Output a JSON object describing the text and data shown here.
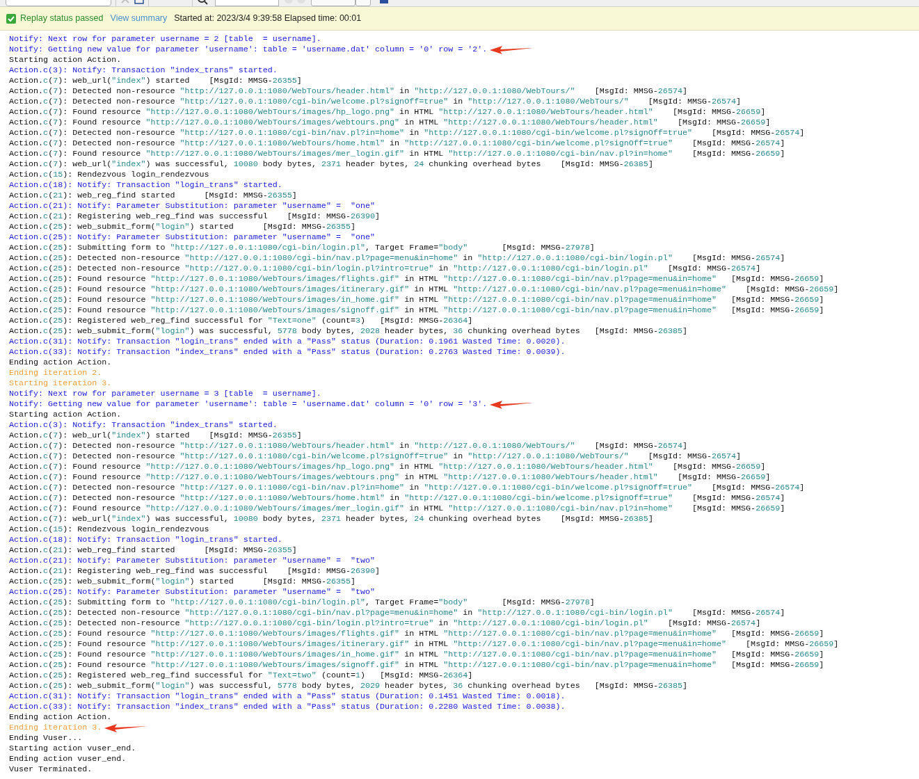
{
  "status_bar": {
    "status": "Replay status passed",
    "passed": true,
    "link": "View summary",
    "info": "Started at: 2023/3/4 9:39:58 Elapsed time: 00:01"
  },
  "log_lines": [
    {
      "kind": "notify",
      "text": "Notify: Next row for parameter username = 2 [table  = username].",
      "arrow": false
    },
    {
      "kind": "notify",
      "text": "Notify: Getting new value for parameter 'username': table = 'username.dat' column = '0' row = '2'.",
      "arrow": true
    },
    {
      "kind": "normal",
      "text": "Starting action Action.",
      "arrow": false
    },
    {
      "kind": "notify",
      "text": "Action.c(3): Notify: Transaction \"index_trans\" started.",
      "arrow": false
    },
    {
      "kind": "normal",
      "text": "Action.c(7): web_url(\"index\") started    [MsgId: MMSG-26355]",
      "arrow": false
    },
    {
      "kind": "normal",
      "text": "Action.c(7): Detected non-resource \"http://127.0.0.1:1080/WebTours/header.html\" in \"http://127.0.0.1:1080/WebTours/\"    [MsgId: MMSG-26574]",
      "arrow": false
    },
    {
      "kind": "normal",
      "text": "Action.c(7): Detected non-resource \"http://127.0.0.1:1080/cgi-bin/welcome.pl?signOff=true\" in \"http://127.0.0.1:1080/WebTours/\"    [MsgId: MMSG-26574]",
      "arrow": false
    },
    {
      "kind": "normal",
      "text": "Action.c(7): Found resource \"http://127.0.0.1:1080/WebTours/images/hp_logo.png\" in HTML \"http://127.0.0.1:1080/WebTours/header.html\"    [MsgId: MMSG-26659]",
      "arrow": false
    },
    {
      "kind": "normal",
      "text": "Action.c(7): Found resource \"http://127.0.0.1:1080/WebTours/images/webtours.png\" in HTML \"http://127.0.0.1:1080/WebTours/header.html\"    [MsgId: MMSG-26659]",
      "arrow": false
    },
    {
      "kind": "normal",
      "text": "Action.c(7): Detected non-resource \"http://127.0.0.1:1080/cgi-bin/nav.pl?in=home\" in \"http://127.0.0.1:1080/cgi-bin/welcome.pl?signOff=true\"    [MsgId: MMSG-26574]",
      "arrow": false
    },
    {
      "kind": "normal",
      "text": "Action.c(7): Detected non-resource \"http://127.0.0.1:1080/WebTours/home.html\" in \"http://127.0.0.1:1080/cgi-bin/welcome.pl?signOff=true\"    [MsgId: MMSG-26574]",
      "arrow": false
    },
    {
      "kind": "normal",
      "text": "Action.c(7): Found resource \"http://127.0.0.1:1080/WebTours/images/mer_login.gif\" in HTML \"http://127.0.0.1:1080/cgi-bin/nav.pl?in=home\"    [MsgId: MMSG-26659]",
      "arrow": false
    },
    {
      "kind": "normal",
      "text": "Action.c(7): web_url(\"index\") was successful, 10080 body bytes, 2371 header bytes, 24 chunking overhead bytes    [MsgId: MMSG-26385]",
      "arrow": false
    },
    {
      "kind": "normal",
      "text": "Action.c(15): Rendezvous login_rendezvous",
      "arrow": false
    },
    {
      "kind": "notify",
      "text": "Action.c(18): Notify: Transaction \"login_trans\" started.",
      "arrow": false
    },
    {
      "kind": "normal",
      "text": "Action.c(21): web_reg_find started      [MsgId: MMSG-26355]",
      "arrow": false
    },
    {
      "kind": "notify",
      "text": "Action.c(21): Notify: Parameter Substitution: parameter \"username\" =  \"one\"",
      "arrow": false
    },
    {
      "kind": "normal",
      "text": "Action.c(21): Registering web_reg_find was successful    [MsgId: MMSG-26390]",
      "arrow": false
    },
    {
      "kind": "normal",
      "text": "Action.c(25): web_submit_form(\"login\") started      [MsgId: MMSG-26355]",
      "arrow": false
    },
    {
      "kind": "notify",
      "text": "Action.c(25): Notify: Parameter Substitution: parameter \"username\" =  \"one\"",
      "arrow": false
    },
    {
      "kind": "normal",
      "text": "Action.c(25): Submitting form to \"http://127.0.0.1:1080/cgi-bin/login.pl\", Target Frame=\"body\"       [MsgId: MMSG-27978]",
      "arrow": false
    },
    {
      "kind": "normal",
      "text": "Action.c(25): Detected non-resource \"http://127.0.0.1:1080/cgi-bin/nav.pl?page=menu&in=home\" in \"http://127.0.0.1:1080/cgi-bin/login.pl\"    [MsgId: MMSG-26574]",
      "arrow": false
    },
    {
      "kind": "normal",
      "text": "Action.c(25): Detected non-resource \"http://127.0.0.1:1080/cgi-bin/login.pl?intro=true\" in \"http://127.0.0.1:1080/cgi-bin/login.pl\"    [MsgId: MMSG-26574]",
      "arrow": false
    },
    {
      "kind": "normal",
      "text": "Action.c(25): Found resource \"http://127.0.0.1:1080/WebTours/images/flights.gif\" in HTML \"http://127.0.0.1:1080/cgi-bin/nav.pl?page=menu&in=home\"   [MsgId: MMSG-26659]",
      "arrow": false
    },
    {
      "kind": "normal",
      "text": "Action.c(25): Found resource \"http://127.0.0.1:1080/WebTours/images/itinerary.gif\" in HTML \"http://127.0.0.1:1080/cgi-bin/nav.pl?page=menu&in=home\"    [MsgId: MMSG-26659]",
      "arrow": false
    },
    {
      "kind": "normal",
      "text": "Action.c(25): Found resource \"http://127.0.0.1:1080/WebTours/images/in_home.gif\" in HTML \"http://127.0.0.1:1080/cgi-bin/nav.pl?page=menu&in=home\"   [MsgId: MMSG-26659]",
      "arrow": false
    },
    {
      "kind": "normal",
      "text": "Action.c(25): Found resource \"http://127.0.0.1:1080/WebTours/images/signoff.gif\" in HTML \"http://127.0.0.1:1080/cgi-bin/nav.pl?page=menu&in=home\"   [MsgId: MMSG-26659]",
      "arrow": false
    },
    {
      "kind": "normal",
      "text": "Action.c(25): Registered web_reg_find successful for \"Text=one\" (count=3)   [MsgId: MMSG-26364]",
      "arrow": false
    },
    {
      "kind": "normal",
      "text": "Action.c(25): web_submit_form(\"login\") was successful, 5778 body bytes, 2028 header bytes, 36 chunking overhead bytes   [MsgId: MMSG-26385]",
      "arrow": false
    },
    {
      "kind": "notify",
      "text": "Action.c(31): Notify: Transaction \"login_trans\" ended with a \"Pass\" status (Duration: 0.1961 Wasted Time: 0.0020).",
      "arrow": false
    },
    {
      "kind": "notify",
      "text": "Action.c(33): Notify: Transaction \"index_trans\" ended with a \"Pass\" status (Duration: 0.2763 Wasted Time: 0.0039).",
      "arrow": false
    },
    {
      "kind": "normal",
      "text": "Ending action Action.",
      "arrow": false
    },
    {
      "kind": "iteration",
      "text": "Ending iteration 2.",
      "arrow": false
    },
    {
      "kind": "iteration",
      "text": "Starting iteration 3.",
      "arrow": false
    },
    {
      "kind": "notify",
      "text": "Notify: Next row for parameter username = 3 [table  = username].",
      "arrow": false
    },
    {
      "kind": "notify",
      "text": "Notify: Getting new value for parameter 'username': table = 'username.dat' column = '0' row = '3'.",
      "arrow": true
    },
    {
      "kind": "normal",
      "text": "Starting action Action.",
      "arrow": false
    },
    {
      "kind": "notify",
      "text": "Action.c(3): Notify: Transaction \"index_trans\" started.",
      "arrow": false
    },
    {
      "kind": "normal",
      "text": "Action.c(7): web_url(\"index\") started    [MsgId: MMSG-26355]",
      "arrow": false
    },
    {
      "kind": "normal",
      "text": "Action.c(7): Detected non-resource \"http://127.0.0.1:1080/WebTours/header.html\" in \"http://127.0.0.1:1080/WebTours/\"    [MsgId: MMSG-26574]",
      "arrow": false
    },
    {
      "kind": "normal",
      "text": "Action.c(7): Detected non-resource \"http://127.0.0.1:1080/cgi-bin/welcome.pl?signOff=true\" in \"http://127.0.0.1:1080/WebTours/\"    [MsgId: MMSG-26574]",
      "arrow": false
    },
    {
      "kind": "normal",
      "text": "Action.c(7): Found resource \"http://127.0.0.1:1080/WebTours/images/hp_logo.png\" in HTML \"http://127.0.0.1:1080/WebTours/header.html\"    [MsgId: MMSG-26659]",
      "arrow": false
    },
    {
      "kind": "normal",
      "text": "Action.c(7): Found resource \"http://127.0.0.1:1080/WebTours/images/webtours.png\" in HTML \"http://127.0.0.1:1080/WebTours/header.html\"    [MsgId: MMSG-26659]",
      "arrow": false
    },
    {
      "kind": "normal",
      "text": "Action.c(7): Detected non-resource \"http://127.0.0.1:1080/cgi-bin/nav.pl?in=home\" in \"http://127.0.0.1:1080/cgi-bin/welcome.pl?signOff=true\"    [MsgId: MMSG-26574]",
      "arrow": false
    },
    {
      "kind": "normal",
      "text": "Action.c(7): Detected non-resource \"http://127.0.0.1:1080/WebTours/home.html\" in \"http://127.0.0.1:1080/cgi-bin/welcome.pl?signOff=true\"    [MsgId: MMSG-26574]",
      "arrow": false
    },
    {
      "kind": "normal",
      "text": "Action.c(7): Found resource \"http://127.0.0.1:1080/WebTours/images/mer_login.gif\" in HTML \"http://127.0.0.1:1080/cgi-bin/nav.pl?in=home\"    [MsgId: MMSG-26659]",
      "arrow": false
    },
    {
      "kind": "normal",
      "text": "Action.c(7): web_url(\"index\") was successful, 10080 body bytes, 2371 header bytes, 24 chunking overhead bytes    [MsgId: MMSG-26385]",
      "arrow": false
    },
    {
      "kind": "normal",
      "text": "Action.c(15): Rendezvous login_rendezvous",
      "arrow": false
    },
    {
      "kind": "notify",
      "text": "Action.c(18): Notify: Transaction \"login_trans\" started.",
      "arrow": false
    },
    {
      "kind": "normal",
      "text": "Action.c(21): web_reg_find started      [MsgId: MMSG-26355]",
      "arrow": false
    },
    {
      "kind": "notify",
      "text": "Action.c(21): Notify: Parameter Substitution: parameter \"username\" =  \"two\"",
      "arrow": false
    },
    {
      "kind": "normal",
      "text": "Action.c(21): Registering web_reg_find was successful    [MsgId: MMSG-26390]",
      "arrow": false
    },
    {
      "kind": "normal",
      "text": "Action.c(25): web_submit_form(\"login\") started      [MsgId: MMSG-26355]",
      "arrow": false
    },
    {
      "kind": "notify",
      "text": "Action.c(25): Notify: Parameter Substitution: parameter \"username\" =  \"two\"",
      "arrow": false
    },
    {
      "kind": "normal",
      "text": "Action.c(25): Submitting form to \"http://127.0.0.1:1080/cgi-bin/login.pl\", Target Frame=\"body\"       [MsgId: MMSG-27978]",
      "arrow": false
    },
    {
      "kind": "normal",
      "text": "Action.c(25): Detected non-resource \"http://127.0.0.1:1080/cgi-bin/nav.pl?page=menu&in=home\" in \"http://127.0.0.1:1080/cgi-bin/login.pl\"    [MsgId: MMSG-26574]",
      "arrow": false
    },
    {
      "kind": "normal",
      "text": "Action.c(25): Detected non-resource \"http://127.0.0.1:1080/cgi-bin/login.pl?intro=true\" in \"http://127.0.0.1:1080/cgi-bin/login.pl\"    [MsgId: MMSG-26574]",
      "arrow": false
    },
    {
      "kind": "normal",
      "text": "Action.c(25): Found resource \"http://127.0.0.1:1080/WebTours/images/flights.gif\" in HTML \"http://127.0.0.1:1080/cgi-bin/nav.pl?page=menu&in=home\"   [MsgId: MMSG-26659]",
      "arrow": false
    },
    {
      "kind": "normal",
      "text": "Action.c(25): Found resource \"http://127.0.0.1:1080/WebTours/images/itinerary.gif\" in HTML \"http://127.0.0.1:1080/cgi-bin/nav.pl?page=menu&in=home\"    [MsgId: MMSG-26659]",
      "arrow": false
    },
    {
      "kind": "normal",
      "text": "Action.c(25): Found resource \"http://127.0.0.1:1080/WebTours/images/in_home.gif\" in HTML \"http://127.0.0.1:1080/cgi-bin/nav.pl?page=menu&in=home\"   [MsgId: MMSG-26659]",
      "arrow": false
    },
    {
      "kind": "normal",
      "text": "Action.c(25): Found resource \"http://127.0.0.1:1080/WebTours/images/signoff.gif\" in HTML \"http://127.0.0.1:1080/cgi-bin/nav.pl?page=menu&in=home\"   [MsgId: MMSG-26659]",
      "arrow": false
    },
    {
      "kind": "normal",
      "text": "Action.c(25): Registered web_reg_find successful for \"Text=two\" (count=1)   [MsgId: MMSG-26364]",
      "arrow": false
    },
    {
      "kind": "normal",
      "text": "Action.c(25): web_submit_form(\"login\") was successful, 5778 body bytes, 2029 header bytes, 36 chunking overhead bytes   [MsgId: MMSG-26385]",
      "arrow": false
    },
    {
      "kind": "notify",
      "text": "Action.c(31): Notify: Transaction \"login_trans\" ended with a \"Pass\" status (Duration: 0.1451 Wasted Time: 0.0018).",
      "arrow": false
    },
    {
      "kind": "notify",
      "text": "Action.c(33): Notify: Transaction \"index_trans\" ended with a \"Pass\" status (Duration: 0.2280 Wasted Time: 0.0038).",
      "arrow": false
    },
    {
      "kind": "normal",
      "text": "Ending action Action.",
      "arrow": false
    },
    {
      "kind": "iteration",
      "text": "Ending iteration 3.",
      "arrow": true
    },
    {
      "kind": "normal",
      "text": "Ending Vuser...",
      "arrow": false
    },
    {
      "kind": "normal",
      "text": "Starting action vuser_end.",
      "arrow": false
    },
    {
      "kind": "normal",
      "text": "Ending action vuser_end.",
      "arrow": false
    },
    {
      "kind": "normal",
      "text": "Vuser Terminated.",
      "arrow": false
    }
  ]
}
